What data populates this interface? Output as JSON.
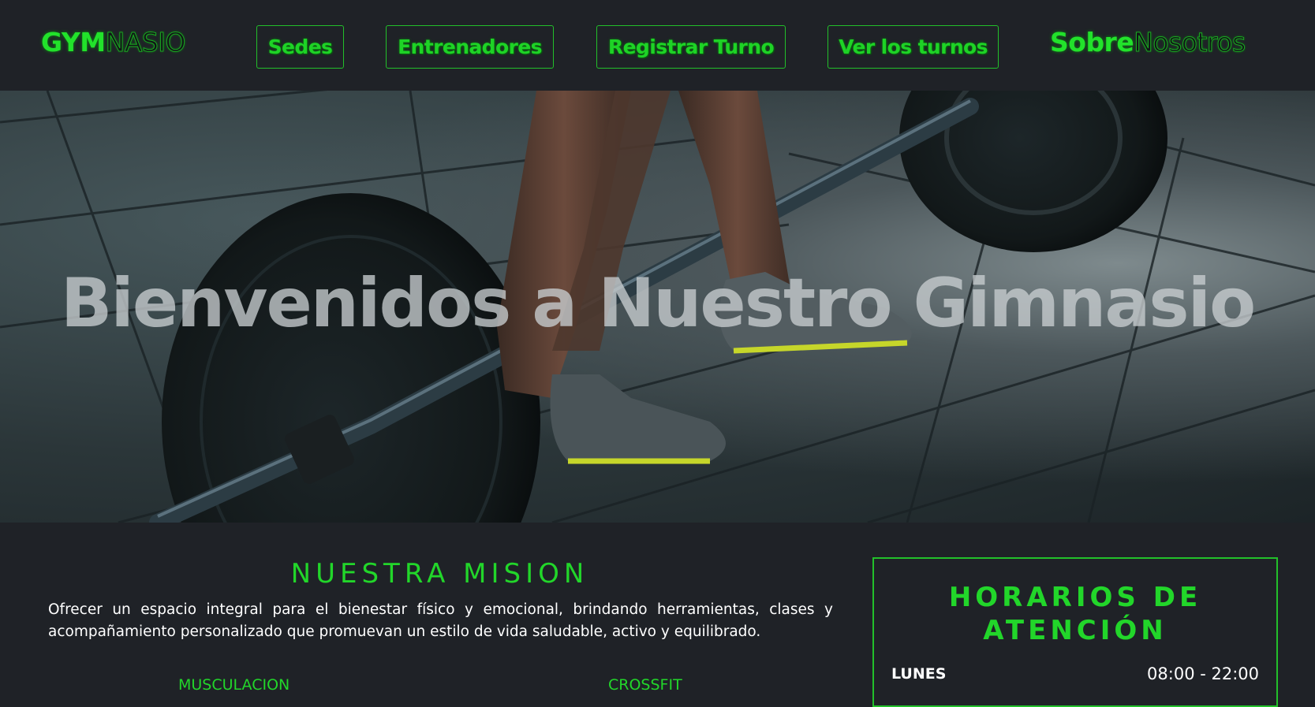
{
  "nav": {
    "brand_primary": "GYM",
    "brand_secondary": "NASIO",
    "links": [
      {
        "label": "Sedes"
      },
      {
        "label": "Entrenadores"
      },
      {
        "label": "Registrar Turno"
      },
      {
        "label": "Ver los turnos"
      }
    ],
    "about_primary": "Sobre",
    "about_secondary": "Nosotros"
  },
  "hero": {
    "title": "Bienvenidos a Nuestro Gimnasio"
  },
  "mision": {
    "title": "NUESTRA MISION",
    "text": "Ofrecer un espacio integral para el bienestar físico y emocional, brindando herramientas, clases y acompañamiento personalizado que promuevan un estilo de vida saludable, activo y equilibrado.",
    "services": [
      "MUSCULACION",
      "CROSSFIT"
    ]
  },
  "hours": {
    "title": "HORARIOS DE ATENCIÓN",
    "rows": [
      {
        "day": "LUNES",
        "time": "08:00 - 22:00"
      }
    ]
  },
  "colors": {
    "accent": "#22d62a",
    "background": "#1f2227"
  }
}
